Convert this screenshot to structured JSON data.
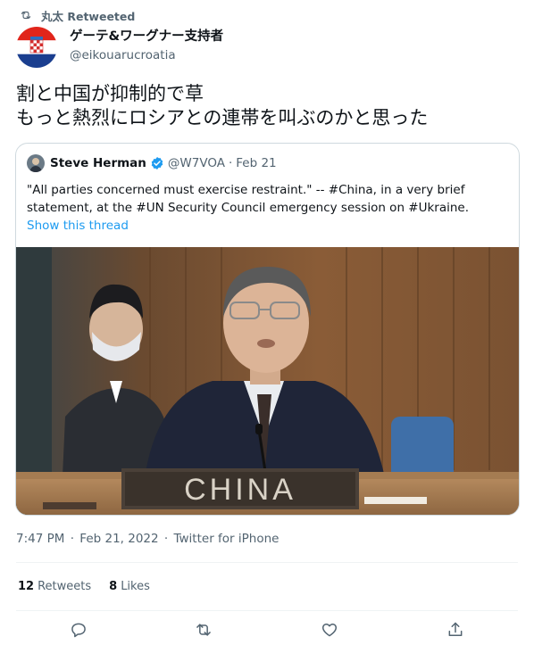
{
  "retweet": {
    "icon": "retweet-icon",
    "label": "丸太 Retweeted"
  },
  "author": {
    "name": "ゲーテ&ワーグナー支持者",
    "handle": "@eikouarucroatia",
    "avatar": "croatian-flag-avatar"
  },
  "tweet": {
    "lines": [
      "割と中国が抑制的で草",
      "もっと熱烈にロシアとの連帯を叫ぶのかと思った"
    ]
  },
  "quote": {
    "name": "Steve Herman",
    "verified": true,
    "handle": "@W7VOA",
    "separator": "·",
    "date": "Feb 21",
    "text_lines": [
      "\"All parties concerned must exercise restraint.\" -- #China, in a very brief",
      "statement, at the #UN Security Council emergency session on #Ukraine."
    ],
    "show_thread": "Show this thread",
    "photo": {
      "nameplate": "CHINA"
    }
  },
  "meta": {
    "time": "7:47 PM",
    "sep1": "·",
    "date": "Feb 21, 2022",
    "sep2": "·",
    "client": "Twitter for iPhone"
  },
  "stats": {
    "retweets_count": "12",
    "retweets_label": "Retweets",
    "likes_count": "8",
    "likes_label": "Likes"
  },
  "colors": {
    "accent": "#1d9bf0",
    "text": "#0f1419",
    "muted": "#536471",
    "border": "#cfd9de"
  }
}
